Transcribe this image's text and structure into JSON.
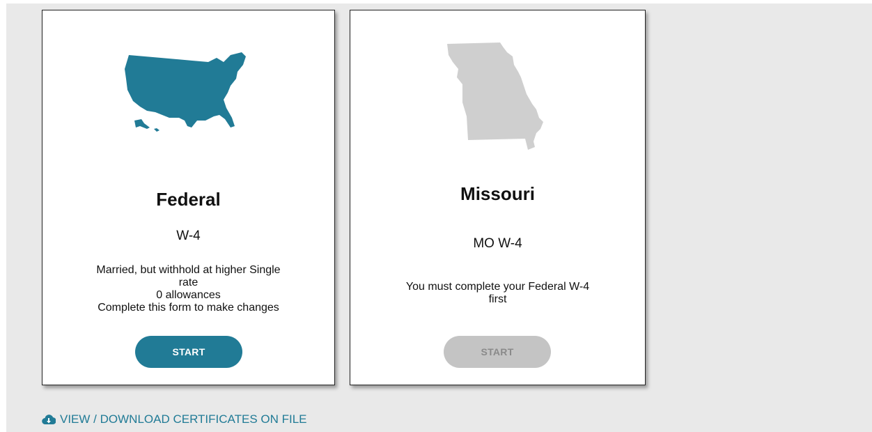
{
  "cards": [
    {
      "title": "Federal",
      "form": "W-4",
      "description": [
        "Married, but withhold at higher Single",
        "rate",
        "0 allowances",
        "Complete this form to make changes"
      ],
      "button_label": "START",
      "button_enabled": true,
      "map_icon": "usa-map-icon",
      "map_color": "#217b96"
    },
    {
      "title": "Missouri",
      "form": "MO W-4",
      "description": [
        "You must complete your Federal W-4",
        "first"
      ],
      "button_label": "START",
      "button_enabled": false,
      "map_icon": "missouri-map-icon",
      "map_color": "#cfcfcf"
    }
  ],
  "footer": {
    "link_icon": "cloud-download-icon",
    "link_label": "VIEW / DOWNLOAD CERTIFICATES ON FILE"
  },
  "colors": {
    "accent": "#217b96",
    "disabled": "#c4c4c4",
    "background": "#e9e9e9"
  }
}
